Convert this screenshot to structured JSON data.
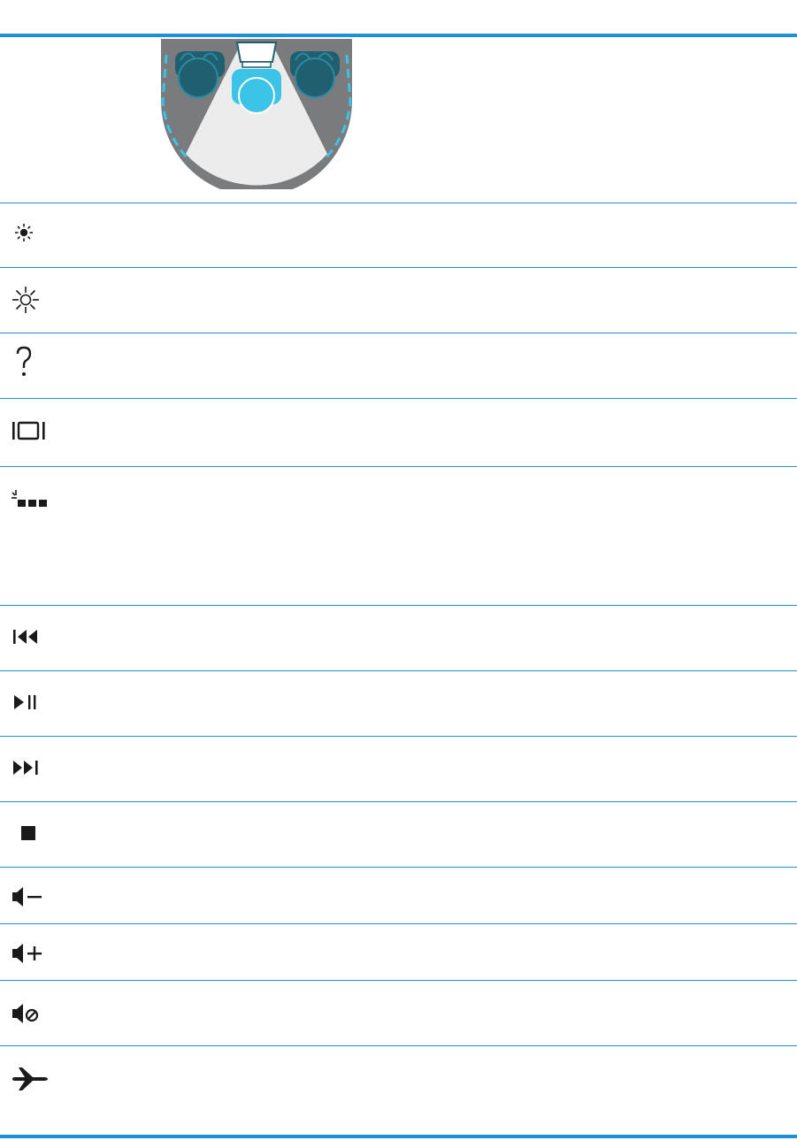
{
  "table": {
    "rows": [
      {
        "key": "privacy-screen",
        "icon": "privacy-screen-illustration"
      },
      {
        "key": "brightness-down",
        "icon": "brightness-down-icon"
      },
      {
        "key": "brightness-up",
        "icon": "brightness-up-icon"
      },
      {
        "key": "help",
        "icon": "question-mark-icon"
      },
      {
        "key": "switch-display",
        "icon": "display-switch-icon"
      },
      {
        "key": "keyboard-backlight",
        "icon": "keyboard-backlight-icon"
      },
      {
        "key": "previous-track",
        "icon": "previous-track-icon"
      },
      {
        "key": "play-pause",
        "icon": "play-pause-icon"
      },
      {
        "key": "next-track",
        "icon": "next-track-icon"
      },
      {
        "key": "stop",
        "icon": "stop-icon"
      },
      {
        "key": "volume-down",
        "icon": "volume-down-icon"
      },
      {
        "key": "volume-up",
        "icon": "volume-up-icon"
      },
      {
        "key": "mute",
        "icon": "mute-icon"
      },
      {
        "key": "airplane-mode",
        "icon": "airplane-icon"
      }
    ]
  },
  "colors": {
    "rule": "#1e8fd6",
    "icon": "#1a1a1a",
    "accent_person": "#3cc3e8",
    "dark_person": "#1f5f70",
    "shade": "#7a7b7d"
  }
}
